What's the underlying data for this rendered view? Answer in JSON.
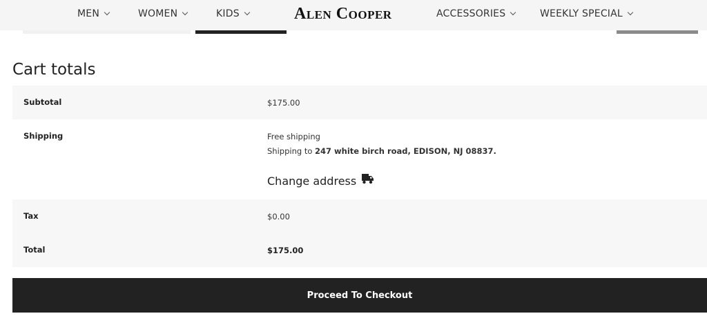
{
  "header": {
    "nav_left": [
      {
        "label": "MEN"
      },
      {
        "label": "WOMEN"
      },
      {
        "label": "KIDS"
      }
    ],
    "logo": "Alen Cooper",
    "nav_right": [
      {
        "label": "ACCESSORIES"
      },
      {
        "label": "WEEKLY SPECIAL"
      }
    ],
    "chevron_icon": "chevron-down-icon"
  },
  "cart": {
    "title": "Cart totals",
    "subtotal": {
      "label": "Subtotal",
      "value": "$175.00"
    },
    "shipping": {
      "label": "Shipping",
      "method": "Free shipping",
      "to_prefix": "Shipping to ",
      "address": "247 white birch road, EDISON, NJ 08837.",
      "change_label": "Change address",
      "change_icon": "truck-icon"
    },
    "tax": {
      "label": "Tax",
      "value": "$0.00"
    },
    "total": {
      "label": "Total",
      "value": "$175.00"
    },
    "checkout_label": "Proceed To Checkout"
  },
  "colors": {
    "header_bg": "#f5f5f5",
    "row_shade": "#f7f7f7",
    "button_bg": "#222222",
    "button_text": "#ffffff"
  }
}
